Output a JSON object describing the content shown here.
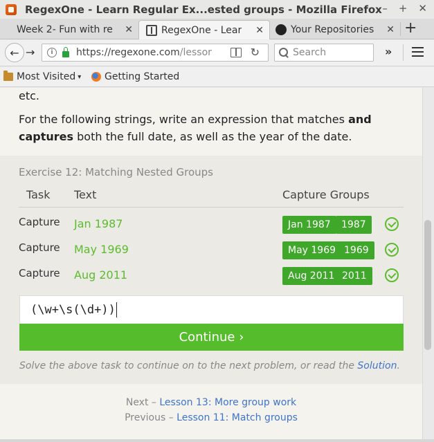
{
  "window": {
    "title": "RegexOne - Learn Regular Ex...ested groups - Mozilla Firefox",
    "controls": [
      "–",
      "+",
      "✕"
    ]
  },
  "tabs": [
    {
      "title": "Week 2- Fun with re",
      "close": "✕"
    },
    {
      "title": "RegexOne - Lear",
      "close": "✕"
    },
    {
      "title": "Your Repositories",
      "close": "✕"
    }
  ],
  "new_tab": "+",
  "nav": {
    "url_host": "https://regexone.com",
    "url_path": "/lessor",
    "search_placeholder": "Search",
    "overflow": "»"
  },
  "bookmarks": [
    {
      "label": "Most Visited",
      "icon": "folder-icon",
      "has_chevron": true
    },
    {
      "label": "Getting Started",
      "icon": "firefox-icon"
    }
  ],
  "content": {
    "etc": "etc.",
    "prompt_pre": "For the following strings, write an expression that matches ",
    "prompt_bold1": "and",
    "prompt_bold2": "captures",
    "prompt_post": " both the full date, as well as the year of the date.",
    "exercise_title": "Exercise 12: Matching Nested Groups",
    "columns": {
      "task": "Task",
      "text": "Text",
      "groups": "Capture Groups"
    },
    "rows": [
      {
        "task": "Capture",
        "text": "Jan 1987",
        "groups": [
          "Jan 1987",
          "1987"
        ],
        "status": "check-icon"
      },
      {
        "task": "Capture",
        "text": "May 1969",
        "groups": [
          "May 1969",
          "1969"
        ],
        "status": "check-icon"
      },
      {
        "task": "Capture",
        "text": "Aug 2011",
        "groups": [
          "Aug 2011",
          "2011"
        ],
        "status": "check-icon"
      }
    ],
    "answer": "(\\w+\\s(\\d+))",
    "continue_label": "Continue ›",
    "hint_pre": "Solve the above task to continue on to the next problem, or read the ",
    "hint_link": "Solution",
    "hint_post": ".",
    "next_prefix": "Next – ",
    "next_link": "Lesson 13: More group work",
    "prev_prefix": "Previous – ",
    "prev_link": "Lesson 11: Match groups"
  },
  "colors": {
    "accent_green": "#55bd2b",
    "pill_green": "#3fa82a",
    "link_blue": "#3f74c9"
  }
}
